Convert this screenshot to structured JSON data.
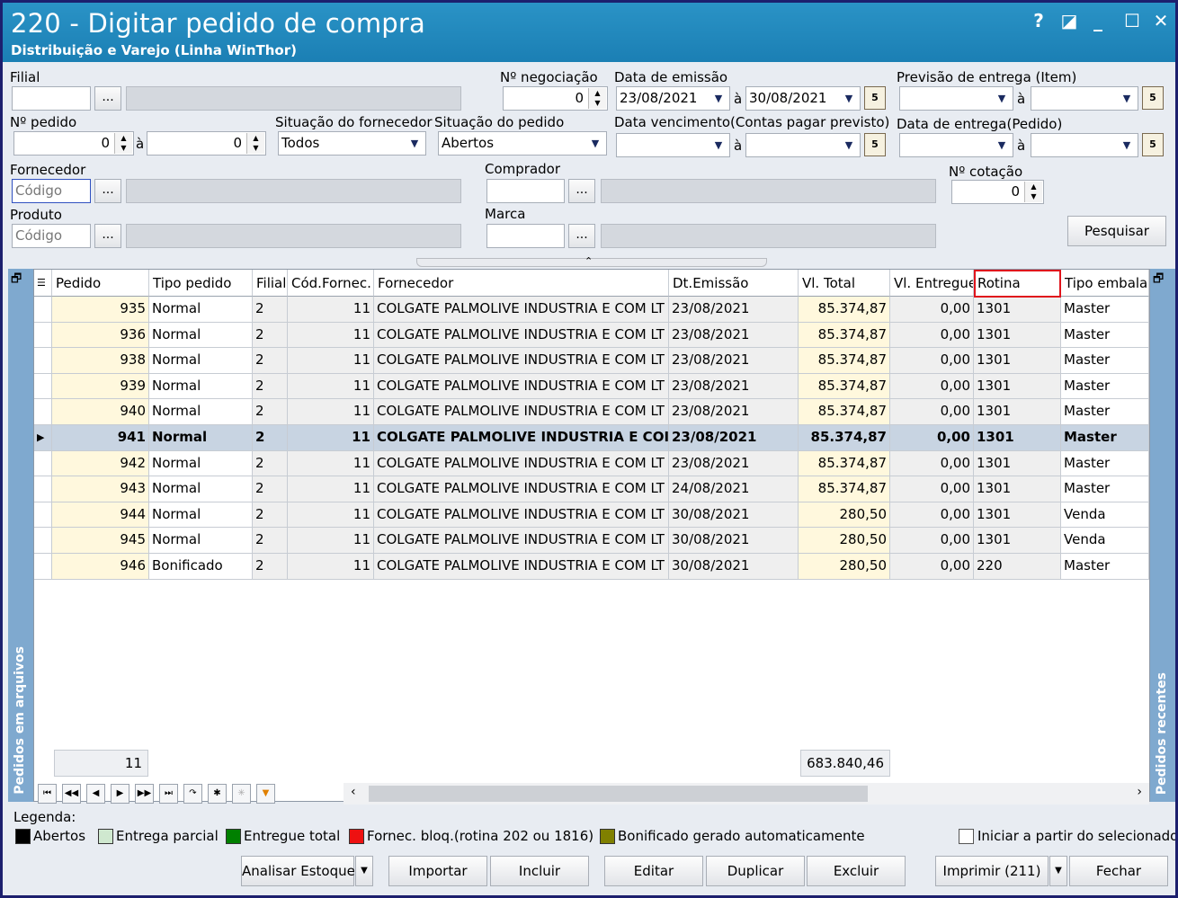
{
  "window": {
    "title": "220 - Digitar pedido de compra",
    "subtitle": "Distribuição e Varejo (Linha WinThor)",
    "help": "?",
    "restore": "◪",
    "minimize": "_",
    "maximize": "☐",
    "close": "✕"
  },
  "filters": {
    "filial_label": "Filial",
    "negociacao_label": "Nº negociação",
    "negociacao_value": "0",
    "data_emissao_label": "Data de emissão",
    "data_emissao_de": "23/08/2021",
    "data_emissao_ate": "30/08/2021",
    "a": "à",
    "previsao_label": "Previsão  de entrega (Item)",
    "nr_pedido_label": "Nº pedido",
    "nr_pedido_de": "0",
    "nr_pedido_ate": "0",
    "sit_fornecedor_label": "Situação do fornecedor",
    "sit_fornecedor_value": "Todos",
    "sit_pedido_label": "Situação do pedido",
    "sit_pedido_value": "Abertos",
    "vencimento_label": "Data vencimento(Contas pagar previsto)",
    "entrega_pedido_label": "Data de entrega(Pedido)",
    "fornecedor_label": "Fornecedor",
    "fornecedor_placeholder": "Código",
    "comprador_label": "Comprador",
    "cotacao_label": "Nº cotação",
    "cotacao_value": "0",
    "produto_label": "Produto",
    "produto_placeholder": "Código",
    "marca_label": "Marca",
    "ellipsis": "...",
    "pesquisar": "Pesquisar"
  },
  "grid": {
    "columns": [
      "Pedido",
      "Tipo pedido",
      "Filial",
      "Cód.Fornec.",
      "Fornecedor",
      "Dt.Emissão",
      "Vl. Total",
      "Vl. Entregue",
      "Rotina",
      "Tipo embalag"
    ],
    "rows": [
      {
        "pedido": "935",
        "tipo": "Normal",
        "filial": "2",
        "cod": "11",
        "forn": "COLGATE PALMOLIVE INDUSTRIA  E COM LT",
        "dt": "23/08/2021",
        "vt": "85.374,87",
        "ve": "0,00",
        "rot": "1301",
        "emb": "Master"
      },
      {
        "pedido": "936",
        "tipo": "Normal",
        "filial": "2",
        "cod": "11",
        "forn": "COLGATE PALMOLIVE INDUSTRIA  E COM LT",
        "dt": "23/08/2021",
        "vt": "85.374,87",
        "ve": "0,00",
        "rot": "1301",
        "emb": "Master"
      },
      {
        "pedido": "938",
        "tipo": "Normal",
        "filial": "2",
        "cod": "11",
        "forn": "COLGATE PALMOLIVE INDUSTRIA  E COM LT",
        "dt": "23/08/2021",
        "vt": "85.374,87",
        "ve": "0,00",
        "rot": "1301",
        "emb": "Master"
      },
      {
        "pedido": "939",
        "tipo": "Normal",
        "filial": "2",
        "cod": "11",
        "forn": "COLGATE PALMOLIVE INDUSTRIA  E COM LT",
        "dt": "23/08/2021",
        "vt": "85.374,87",
        "ve": "0,00",
        "rot": "1301",
        "emb": "Master"
      },
      {
        "pedido": "940",
        "tipo": "Normal",
        "filial": "2",
        "cod": "11",
        "forn": "COLGATE PALMOLIVE INDUSTRIA  E COM LT",
        "dt": "23/08/2021",
        "vt": "85.374,87",
        "ve": "0,00",
        "rot": "1301",
        "emb": "Master"
      },
      {
        "pedido": "941",
        "tipo": "Normal",
        "filial": "2",
        "cod": "11",
        "forn": "COLGATE PALMOLIVE INDUSTRIA  E COI",
        "dt": "23/08/2021",
        "vt": "85.374,87",
        "ve": "0,00",
        "rot": "1301",
        "emb": "Master"
      },
      {
        "pedido": "942",
        "tipo": "Normal",
        "filial": "2",
        "cod": "11",
        "forn": "COLGATE PALMOLIVE INDUSTRIA  E COM LT",
        "dt": "23/08/2021",
        "vt": "85.374,87",
        "ve": "0,00",
        "rot": "1301",
        "emb": "Master"
      },
      {
        "pedido": "943",
        "tipo": "Normal",
        "filial": "2",
        "cod": "11",
        "forn": "COLGATE PALMOLIVE INDUSTRIA  E COM LT",
        "dt": "24/08/2021",
        "vt": "85.374,87",
        "ve": "0,00",
        "rot": "1301",
        "emb": "Master"
      },
      {
        "pedido": "944",
        "tipo": "Normal",
        "filial": "2",
        "cod": "11",
        "forn": "COLGATE PALMOLIVE INDUSTRIA  E COM LT",
        "dt": "30/08/2021",
        "vt": "280,50",
        "ve": "0,00",
        "rot": "1301",
        "emb": "Venda"
      },
      {
        "pedido": "945",
        "tipo": "Normal",
        "filial": "2",
        "cod": "11",
        "forn": "COLGATE PALMOLIVE INDUSTRIA  E COM LT",
        "dt": "30/08/2021",
        "vt": "280,50",
        "ve": "0,00",
        "rot": "1301",
        "emb": "Venda"
      },
      {
        "pedido": "946",
        "tipo": "Bonificado",
        "filial": "2",
        "cod": "11",
        "forn": "COLGATE PALMOLIVE INDUSTRIA  E COM LT",
        "dt": "30/08/2021",
        "vt": "280,50",
        "ve": "0,00",
        "rot": "220",
        "emb": "Master"
      }
    ],
    "selected_pedido": "941",
    "footer_count": "11",
    "footer_total": "683.840,46",
    "sort_indicator": "△",
    "highlight_color": "#e0141c"
  },
  "side_panels": {
    "left": "Pedidos em arquivos",
    "right": "Pedidos recentes"
  },
  "legend": {
    "title": "Legenda:",
    "items": [
      {
        "label": "Abertos",
        "color": "#000000"
      },
      {
        "label": "Entrega parcial",
        "color": "#cfe8cf"
      },
      {
        "label": "Entregue total",
        "color": "#008000"
      },
      {
        "label": "Fornec. bloq.(rotina 202 ou 1816)",
        "color": "#ee1111"
      },
      {
        "label": "Bonificado gerado automaticamente",
        "color": "#808000"
      }
    ],
    "checkbox_label": "Iniciar a partir do selecionado"
  },
  "buttons": {
    "analisar": "Analisar Estoque",
    "importar": "Importar",
    "incluir": "Incluir",
    "editar": "Editar",
    "duplicar": "Duplicar",
    "excluir": "Excluir",
    "imprimir": "Imprimir (211)",
    "fechar": "Fechar"
  }
}
